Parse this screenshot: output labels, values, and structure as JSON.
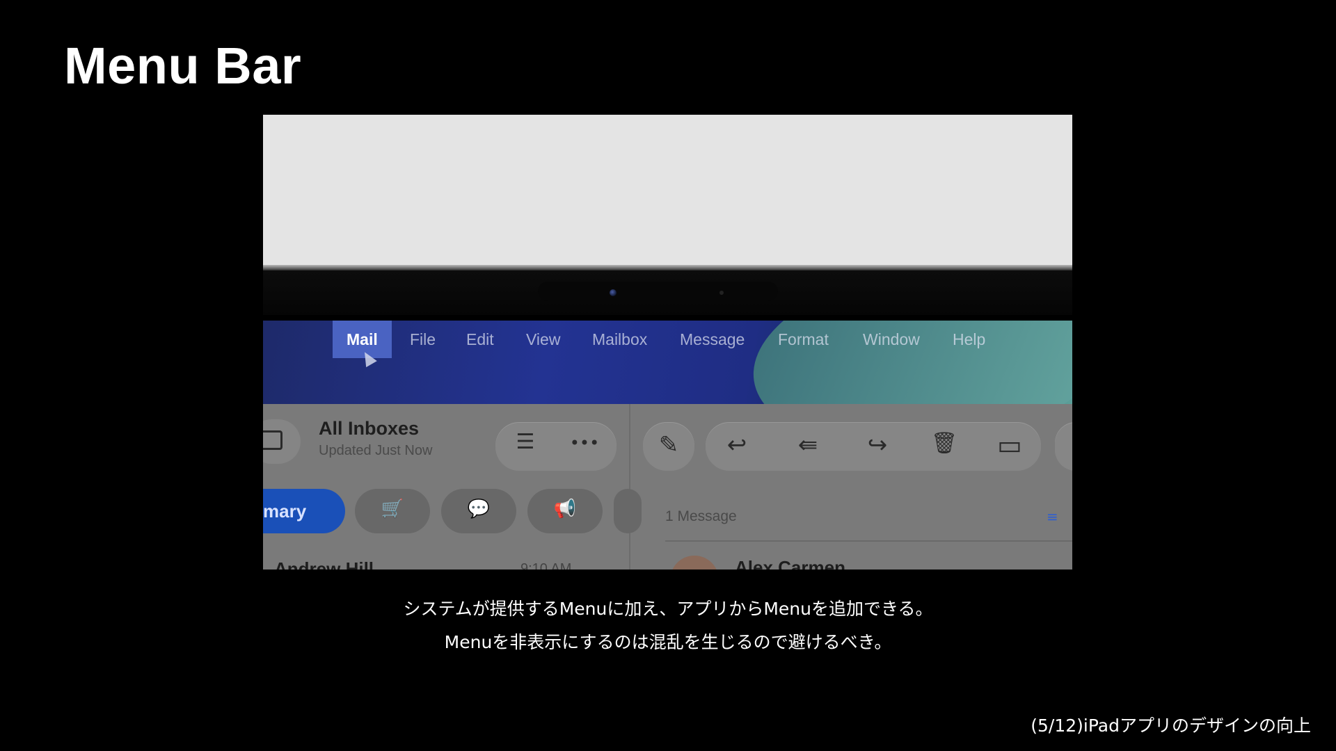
{
  "slide": {
    "title": "Menu Bar",
    "caption_line1": "システムが提供するMenuに加え、アプリからMenuを追加できる。",
    "caption_line2": "Menuを非表示にするのは混乱を生じるので避けるべき。",
    "footer": "(5/12)iPadアプリのデザインの向上"
  },
  "menubar": {
    "items": [
      "Mail",
      "File",
      "Edit",
      "View",
      "Mailbox",
      "Message",
      "Format",
      "Window",
      "Help"
    ],
    "active": "Mail"
  },
  "mail_app": {
    "inbox_title": "All Inboxes",
    "inbox_subtitle": "Updated Just Now",
    "primary_tab": "mary",
    "message_count": "1 Message",
    "sender_partial": "Alex Carmen",
    "row_name_partial": "Andrew Hill",
    "row_time_partial": "9:10 AM",
    "summary_icon": "≡"
  },
  "icons": {
    "sidebar": "sidebar-icon",
    "filter": "☰",
    "more": "•••",
    "compose": "✎",
    "reply": "↩",
    "reply_all": "⇚",
    "forward": "↪",
    "trash": "🗑",
    "folder": "▭",
    "cart": "🛒",
    "chat": "💬",
    "megaphone": "📢"
  },
  "colors": {
    "menu_active_bg": "#4a63c2",
    "primary_tab_bg": "#1a50b8",
    "screen_top": "#e4e4e4"
  }
}
